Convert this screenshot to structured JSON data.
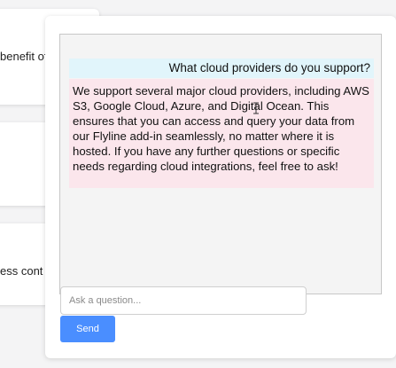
{
  "background_cards": [
    {
      "text": "benefit of"
    },
    {
      "text": ""
    },
    {
      "text": "ess cont"
    }
  ],
  "chat": {
    "messages": [
      {
        "role": "user",
        "text": "What cloud providers do you support?"
      },
      {
        "role": "assistant",
        "text": "We support several major cloud providers, including AWS S3, Google Cloud, Azure, and Digital Ocean. This ensures that you can access and query your data from our Flyline add-in seamlessly, no matter where it is hosted. If you have any further questions or specific needs regarding cloud integrations, feel free to ask!"
      }
    ],
    "input": {
      "value": "",
      "placeholder": "Ask a question..."
    },
    "send_label": "Send"
  },
  "colors": {
    "user_bubble": "#e1f5fb",
    "assistant_bubble": "#fbe6ec",
    "send_button": "#4a8eff"
  },
  "icons": {
    "cursor": "text-cursor-icon"
  }
}
